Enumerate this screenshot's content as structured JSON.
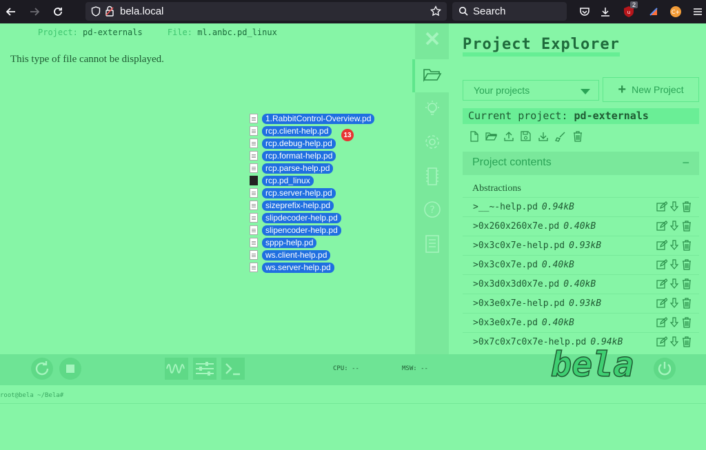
{
  "browser": {
    "url": "bela.local",
    "search_placeholder": "Search",
    "extension_badge": "2"
  },
  "editor": {
    "project_label": "Project:",
    "project_value": "pd-externals",
    "file_label": "File:",
    "file_value": "ml.anbc.pd_linux",
    "message": "This type of file cannot be displayed."
  },
  "drag": {
    "count": "13",
    "files": [
      "1.RabbitControl-Overview.pd",
      "rcp.client-help.pd",
      "rcp.debug-help.pd",
      "rcp.format-help.pd",
      "rcp.parse-help.pd",
      "rcp.pd_linux",
      "rcp.server-help.pd",
      "sizeprefix-help.pd",
      "slipdecoder-help.pd",
      "slipencoder-help.pd",
      "sppp-help.pd",
      "ws.client-help.pd",
      "ws.server-help.pd"
    ]
  },
  "explorer": {
    "title": "Project Explorer",
    "select_value": "Your projects",
    "new_project_label": "New Project",
    "current_label": "Current project:",
    "current_value": "pd-externals",
    "contents_label": "Project contents",
    "section_label": "Abstractions",
    "files": [
      {
        "name": ">__~-help.pd",
        "size": "0.94kB"
      },
      {
        "name": ">0x260x260x7e.pd",
        "size": "0.40kB"
      },
      {
        "name": ">0x3c0x7e-help.pd",
        "size": "0.93kB"
      },
      {
        "name": ">0x3c0x7e.pd",
        "size": "0.40kB"
      },
      {
        "name": ">0x3d0x3d0x7e.pd",
        "size": "0.40kB"
      },
      {
        "name": ">0x3e0x7e-help.pd",
        "size": "0.93kB"
      },
      {
        "name": ">0x3e0x7e.pd",
        "size": "0.40kB"
      },
      {
        "name": ">0x7c0x7c0x7e-help.pd",
        "size": "0.94kB"
      }
    ]
  },
  "controls": {
    "cpu_label": "CPU: --",
    "msw_label": "MSW: --",
    "logo_text": "bela"
  },
  "console": {
    "prompt": "root@bela ~/Bela#"
  },
  "colors": {
    "background": "#86f5a6",
    "accent": "#1f6b3c",
    "drag_pill": "#1f6fe0",
    "badge": "#e83333"
  }
}
